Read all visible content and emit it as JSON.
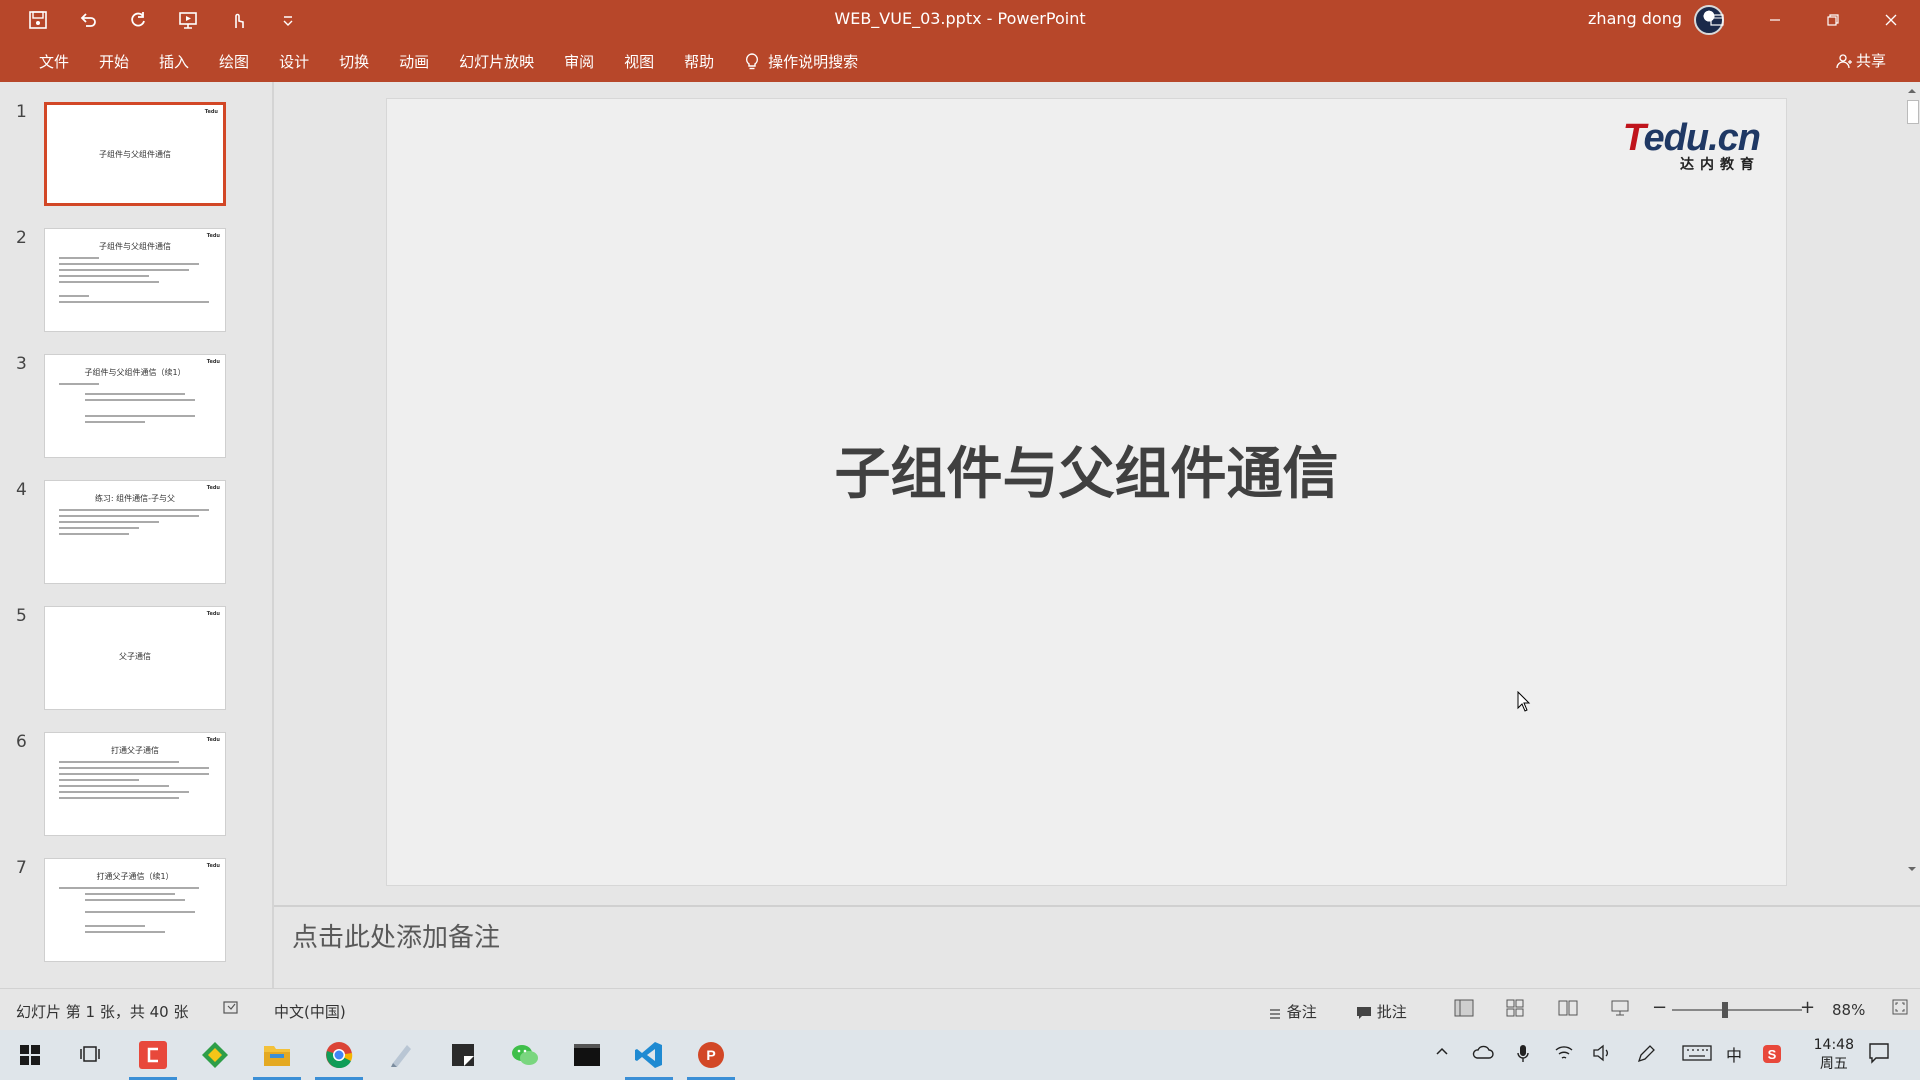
{
  "title_bar": {
    "document_title": "WEB_VUE_03.pptx  -  PowerPoint",
    "user_name": "zhang dong",
    "quick_access": [
      "save-icon",
      "undo-icon",
      "redo-icon",
      "present-icon",
      "touch-mode-icon",
      "customize-icon"
    ],
    "window_controls": [
      "ribbon-display-icon",
      "minimize-icon",
      "restore-icon",
      "close-icon"
    ]
  },
  "ribbon": {
    "tabs": [
      "文件",
      "开始",
      "插入",
      "绘图",
      "设计",
      "切换",
      "动画",
      "幻灯片放映",
      "审阅",
      "视图",
      "帮助"
    ],
    "tell_me": "操作说明搜索",
    "share": "共享"
  },
  "thumbnails": [
    {
      "num": "1",
      "title": "子组件与父组件通信",
      "selected": true
    },
    {
      "num": "2",
      "title": "子组件与父组件通信",
      "selected": false
    },
    {
      "num": "3",
      "title": "子组件与父组件通信（续1）",
      "selected": false
    },
    {
      "num": "4",
      "title": "练习: 组件通信-子与父",
      "selected": false
    },
    {
      "num": "5",
      "title": "父子通信",
      "selected": false
    },
    {
      "num": "6",
      "title": "打通父子通信",
      "selected": false
    },
    {
      "num": "7",
      "title": "打通父子通信（续1）",
      "selected": false
    }
  ],
  "slide": {
    "title": "子组件与父组件通信",
    "logo_brand_red": "T",
    "logo_brand_rest": "edu.cn",
    "logo_sub": "达内教育"
  },
  "notes": {
    "placeholder": "点击此处添加备注"
  },
  "status_bar": {
    "slide_info": "幻灯片 第 1 张，共 40 张",
    "language": "中文(中国)",
    "notes_label": "备注",
    "comments_label": "批注",
    "zoom_percent": "88%",
    "zoom_minus": "−",
    "zoom_plus": "+"
  },
  "taskbar": {
    "apps": [
      "start-icon",
      "task-view-icon",
      "app-red-icon",
      "app-green-icon",
      "file-explorer-icon",
      "chrome-icon",
      "brush-app-icon",
      "notes-app-icon",
      "wechat-icon",
      "terminal-icon",
      "vscode-icon",
      "powerpoint-icon"
    ],
    "time": "14:48",
    "day": "周五",
    "ime": "中"
  },
  "colors": {
    "accent": "#b7472a",
    "selection": "#d24726"
  }
}
